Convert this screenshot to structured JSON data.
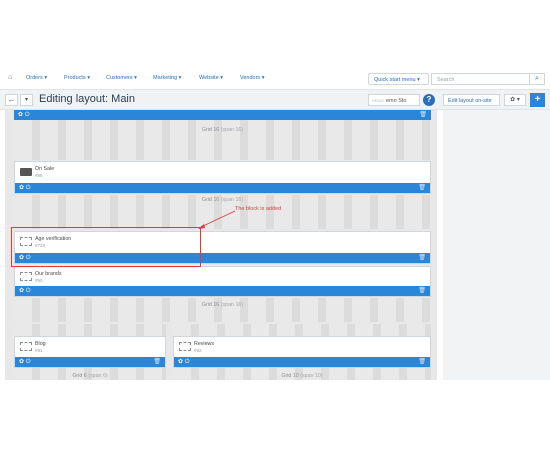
{
  "nav": {
    "items": [
      "Orders ▾",
      "Products ▾",
      "Customers ▾",
      "Marketing ▾",
      "Website ▾",
      "Vendors ▾"
    ],
    "quick_start": "Quick start menu ▾",
    "search_placeholder": "Search"
  },
  "titlebar": {
    "title": "Editing layout: Main",
    "store_prefix": "DEMO",
    "store_name": "emo Sto",
    "edit_layout": "Edit layout on-site",
    "gear": "✿ ▾",
    "plus": "+"
  },
  "grids": [
    {
      "label": "Grid 16",
      "span": "(span 16)"
    },
    {
      "label": "Grid 16",
      "span": "(span 16)"
    },
    {
      "label": "Grid 16",
      "span": "(span 16)"
    },
    {
      "label": "Grid 6",
      "span": "(span 6)"
    },
    {
      "label": "Grid 10",
      "span": "(span 10)"
    }
  ],
  "blocks": {
    "on_sale": {
      "name": "On Sale",
      "id": "#85"
    },
    "age": {
      "name": "Age verification",
      "id": "#733"
    },
    "brands": {
      "name": "Our brands",
      "id": "#90"
    },
    "blog": {
      "name": "Blog",
      "id": "#91"
    },
    "reviews": {
      "name": "Reviews",
      "id": "#92"
    }
  },
  "annotation": {
    "text": "The block is added",
    "color": "#e53935"
  },
  "colors": {
    "accent": "#2a86d9",
    "link": "#2a6ebb"
  }
}
